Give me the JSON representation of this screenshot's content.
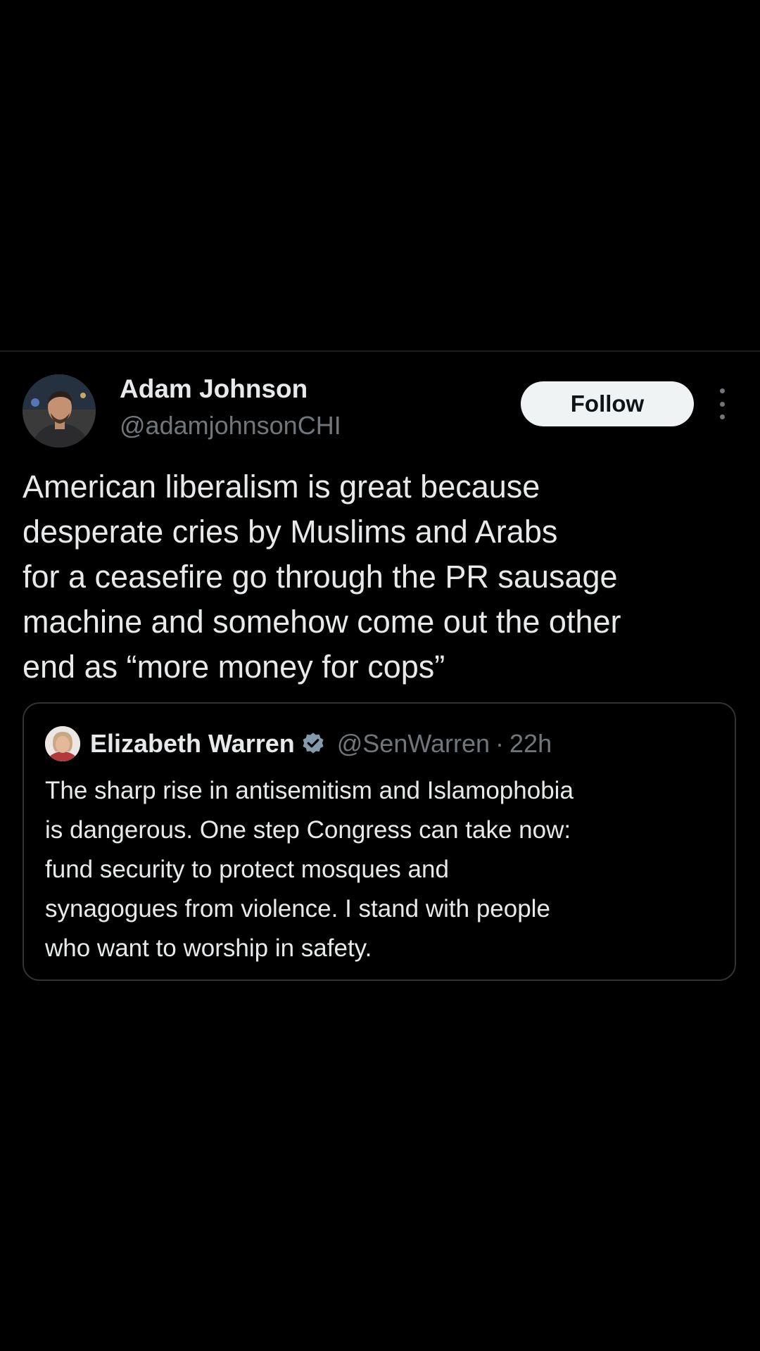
{
  "post": {
    "author": {
      "name": "Adam Johnson",
      "handle": "@adamjohnsonCHI"
    },
    "follow_label": "Follow",
    "text": "American liberalism is great because\ndesperate cries by Muslims and Arabs\nfor a ceasefire go through the PR sausage\nmachine and somehow come out the other\nend as “more money for cops”"
  },
  "quoted_post": {
    "author": {
      "name": "Elizabeth Warren",
      "handle": "@SenWarren",
      "verified": true
    },
    "separator": "·",
    "time": "22h",
    "text": "The sharp rise in antisemitism and Islamophobia\nis dangerous. One step Congress can take now:\nfund security to protect mosques and\nsynagogues from violence. I stand with people\nwho want to worship in safety."
  },
  "icons": {
    "more": "more-vertical-icon",
    "verified": "verified-badge-icon"
  },
  "colors": {
    "background": "#000000",
    "text_primary": "#e7e9ea",
    "text_secondary": "#71767b",
    "border": "#2f3336",
    "follow_button_bg": "#eff3f4",
    "follow_button_text": "#0f1419",
    "verified_badge": "#829aab"
  }
}
